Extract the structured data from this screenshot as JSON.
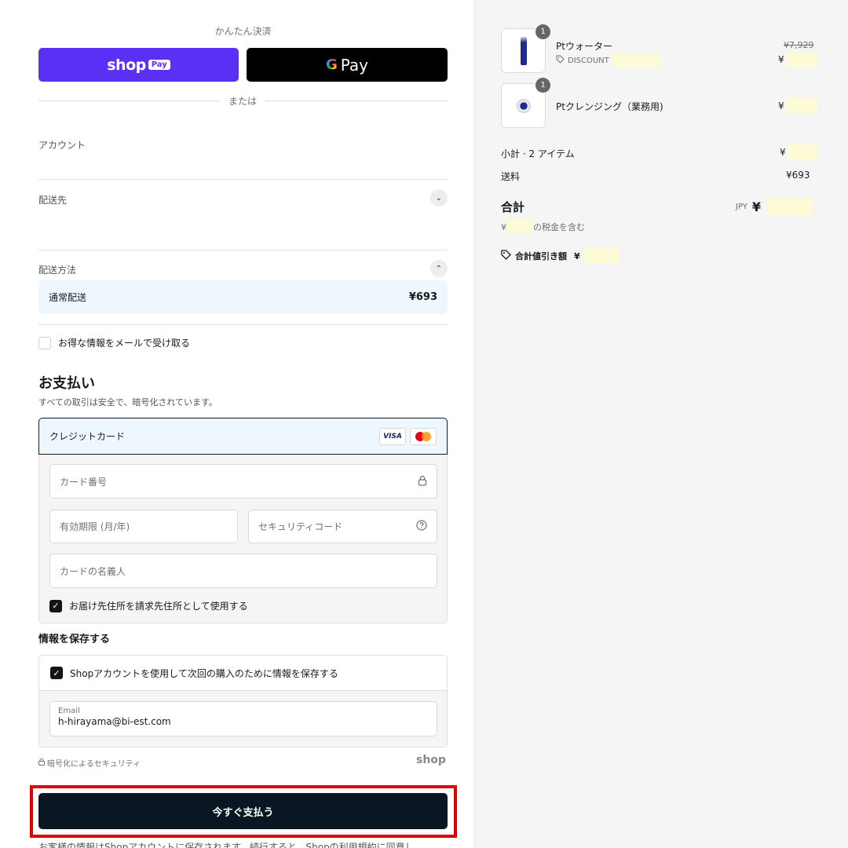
{
  "express": {
    "title": "かんたん決済",
    "shop_pay_word": "shop",
    "shop_pay_tag": "Pay",
    "gpay_g": "G",
    "gpay_label": "Pay",
    "or_text": "または"
  },
  "account": {
    "label": "アカウント"
  },
  "delivery": {
    "label": "配送先"
  },
  "shipping_method": {
    "label": "配送方法",
    "option_name": "通常配送",
    "option_price": "¥693"
  },
  "newsletter": {
    "label": "お得な情報をメールで受け取る",
    "checked": false
  },
  "payment": {
    "title": "お支払い",
    "subtitle": "すべての取引は安全で、暗号化されています。",
    "method_label": "クレジットカード",
    "visa_label": "VISA",
    "card_number_placeholder": "カード番号",
    "expiry_placeholder": "有効期限 (月/年)",
    "security_code_placeholder": "セキュリティコード",
    "name_placeholder": "カードの名義人",
    "billing_same_label": "お届け先住所を請求先住所として使用する"
  },
  "save_info": {
    "title": "情報を保存する",
    "shop_account_label": "Shopアカウントを使用して次回の購入のために情報を保存する",
    "email_label": "Email",
    "email_value": "h-hirayama@bi-est.com"
  },
  "security": {
    "note": "暗号化によるセキュリティ",
    "shop_logo": "shop"
  },
  "pay_now": {
    "label": "今すぐ支払う"
  },
  "footnote": "お客様の情報はShopアカウントに保存されます。続行すると、Shopの利用規約に同意し",
  "summary": {
    "items": [
      {
        "qty": "1",
        "name": "Ptウォーター",
        "compare_price": "¥7,929",
        "discount_label": "DISCOUNT",
        "price": "¥"
      },
      {
        "qty": "1",
        "name": "Ptクレンジング（業務用)",
        "price": "¥"
      }
    ],
    "subtotal_label": "小計 · 2 アイテム",
    "subtotal_value": "¥",
    "shipping_label": "送料",
    "shipping_value": "¥693",
    "total_label": "合計",
    "currency": "JPY",
    "total_symbol": "¥",
    "tax_prefix": "¥",
    "tax_suffix": "の税金を含む",
    "total_discount_label": "合計値引き額",
    "total_discount_value": "¥"
  },
  "colors": {
    "shop_pay": "#5a31f4",
    "pay_now": "#0a1722",
    "highlight": "#fdfbd6",
    "annotation": "#e00000"
  }
}
